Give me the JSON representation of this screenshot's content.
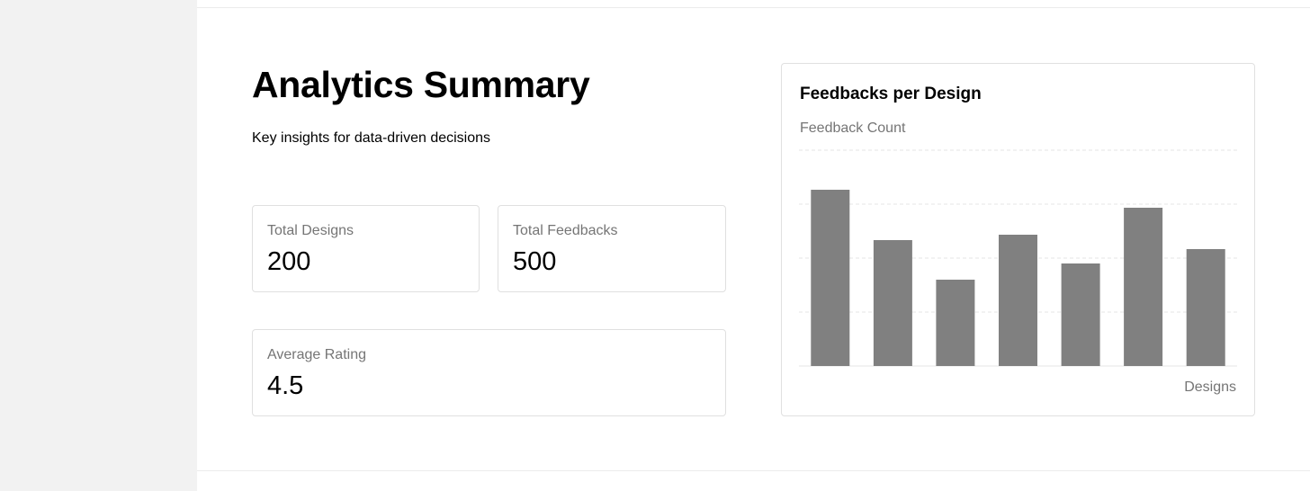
{
  "page": {
    "title": "Analytics Summary",
    "subtitle": "Key insights for data-driven decisions"
  },
  "stats": {
    "total_designs": {
      "label": "Total Designs",
      "value": "200"
    },
    "total_feedbacks": {
      "label": "Total Feedbacks",
      "value": "500"
    },
    "average_rating": {
      "label": "Average Rating",
      "value": "4.5"
    }
  },
  "colors": {
    "sidebar": "#f2f2f2",
    "bar": "#808080",
    "grid": "#e6e6e6",
    "muted_text": "#757575"
  },
  "chart_data": {
    "type": "bar",
    "title": "Feedbacks per Design",
    "ylabel": "Feedback Count",
    "xlabel": "Designs",
    "categories": [
      "",
      "",
      "",
      "",
      "",
      "",
      ""
    ],
    "values": [
      98,
      70,
      48,
      73,
      57,
      88,
      65
    ],
    "ylim": [
      0,
      120
    ],
    "grid": true,
    "legend": "none"
  }
}
